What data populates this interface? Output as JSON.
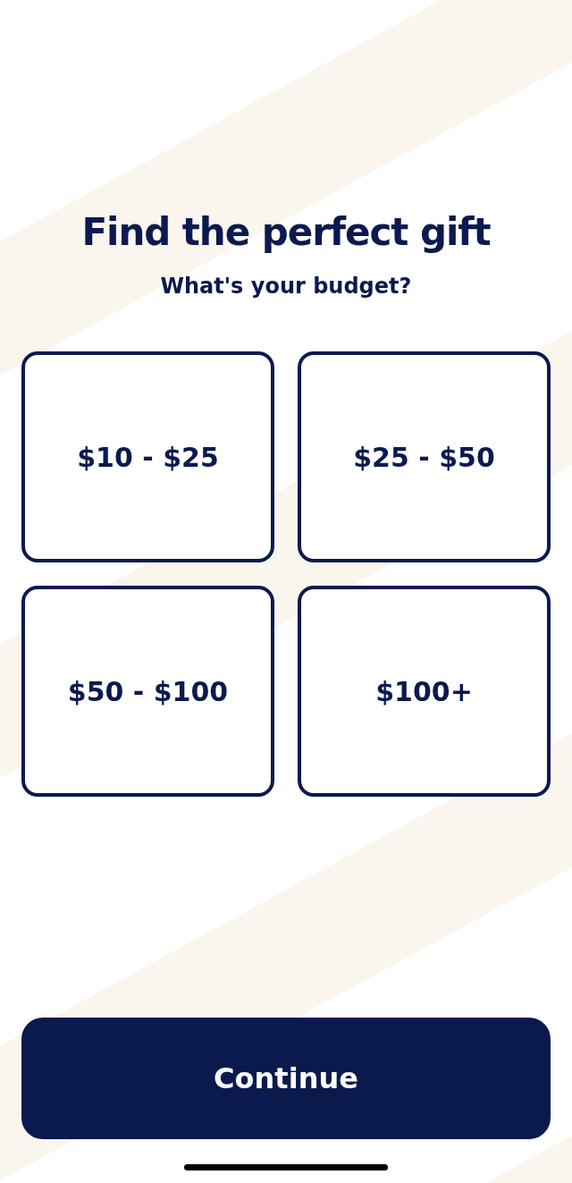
{
  "title": "Find the perfect gift",
  "subtitle": "What's your budget?",
  "options": [
    {
      "label": "$10 - $25",
      "selected": false
    },
    {
      "label": "$25 - $50",
      "selected": false
    },
    {
      "label": "$50 - $100",
      "selected": false
    },
    {
      "label": "$100+",
      "selected": false
    }
  ],
  "button": {
    "label": "Continue"
  }
}
